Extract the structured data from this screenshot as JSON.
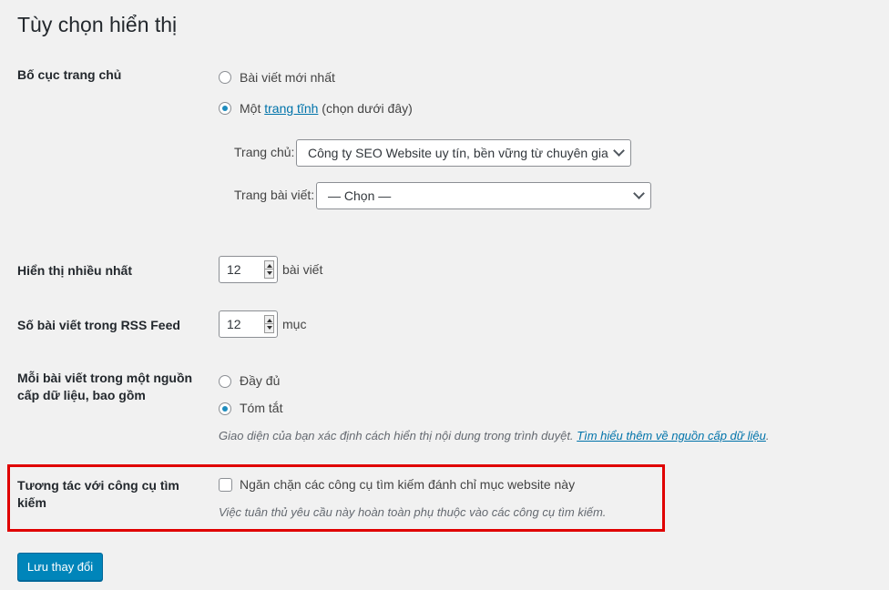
{
  "page_title": "Tùy chọn hiển thị",
  "homepage": {
    "label": "Bố cục trang chủ",
    "option_latest": "Bài viết mới nhất",
    "option_static_prefix": "Một",
    "option_static_link": "trang tĩnh",
    "option_static_suffix": "(chọn dưới đây)",
    "selected": "static",
    "front_label": "Trang chủ:",
    "front_value": "Công ty SEO Website uy tín, bền vững từ chuyên gia",
    "posts_label": "Trang bài viết:",
    "posts_value": "— Chọn —"
  },
  "posts_per_page": {
    "label": "Hiển thị nhiều nhất",
    "value": "12",
    "unit": "bài viết"
  },
  "rss": {
    "label": "Số bài viết trong RSS Feed",
    "value": "12",
    "unit": "mục"
  },
  "feed_content": {
    "label": "Mỗi bài viết trong một nguồn cấp dữ liệu, bao gồm",
    "option_full": "Đầy đủ",
    "option_summary": "Tóm tắt",
    "selected": "summary",
    "desc_text": "Giao diện của bạn xác định cách hiển thị nội dung trong trình duyệt.",
    "desc_link": "Tìm hiểu thêm về nguồn cấp dữ liệu",
    "desc_end": "."
  },
  "search_engine": {
    "label": "Tương tác với công cụ tìm kiếm",
    "checkbox_label": "Ngăn chặn các công cụ tìm kiếm đánh chỉ mục website này",
    "checked": false,
    "desc": "Việc tuân thủ yêu cầu này hoàn toàn phụ thuộc vào các công cụ tìm kiếm.",
    "highlight_color": "#e00000"
  },
  "save_button": "Lưu thay đổi",
  "colors": {
    "accent": "#0073aa",
    "button": "#0085ba",
    "radio_dot": "#1e8cbe"
  }
}
